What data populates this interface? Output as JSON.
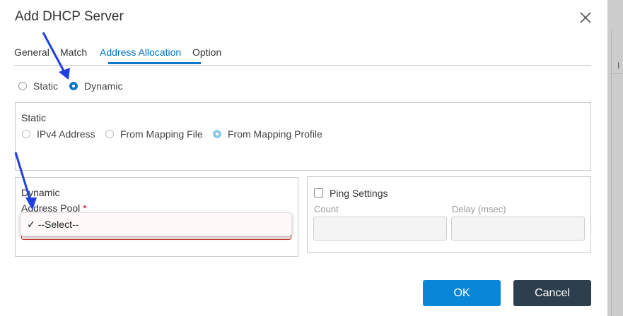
{
  "background": {
    "cut_text": "I"
  },
  "dialog": {
    "title": "Add DHCP Server",
    "close_icon": "close-icon",
    "tabs": [
      {
        "label": "General",
        "active": false
      },
      {
        "label": "Match",
        "active": false
      },
      {
        "label": "Address Allocation",
        "active": true
      },
      {
        "label": "Option",
        "active": false
      }
    ],
    "allocation_mode": {
      "options": [
        {
          "label": "Static",
          "checked": false
        },
        {
          "label": "Dynamic",
          "checked": true
        }
      ]
    },
    "static_panel": {
      "label": "Static",
      "options": [
        {
          "label": "IPv4 Address",
          "checked": false
        },
        {
          "label": "From Mapping File",
          "checked": false
        },
        {
          "label": "From Mapping Profile",
          "checked": true
        }
      ]
    },
    "dynamic_panel": {
      "label": "Dynamic",
      "address_pool_label": "Address Pool",
      "required_marker": "*",
      "select": {
        "selected": "--Select--",
        "check": "✓"
      }
    },
    "ping_panel": {
      "label": "Ping Settings",
      "checked": false,
      "count_label": "Count",
      "delay_label": "Delay (msec)",
      "count_value": "",
      "delay_value": ""
    },
    "buttons": {
      "ok": "OK",
      "cancel": "Cancel"
    }
  },
  "colors": {
    "accent": "#0a78c8",
    "ok": "#0a86d8",
    "cancel": "#2d3e4c",
    "required": "#d0021b",
    "annotation_arrow": "#1f3fe0"
  }
}
